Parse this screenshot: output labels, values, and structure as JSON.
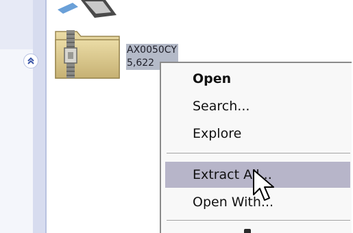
{
  "file": {
    "name": "AX0050CY",
    "detail": "5,622"
  },
  "context_menu": {
    "items": [
      {
        "label": "Open",
        "bold": true
      },
      {
        "label": "Search..."
      },
      {
        "label": "Explore"
      },
      {
        "label": "Extract All...",
        "highlighted": true
      },
      {
        "label": "Open With..."
      }
    ]
  },
  "colors": {
    "highlight": "#b7b5c9",
    "menu_background": "#f8f8f8",
    "task_pane": "#d7dcef",
    "folder": "#d9c68a"
  },
  "icons": [
    "collapse-chevrons-icon",
    "zip-folder-icon",
    "mouse-pointer-icon"
  ]
}
